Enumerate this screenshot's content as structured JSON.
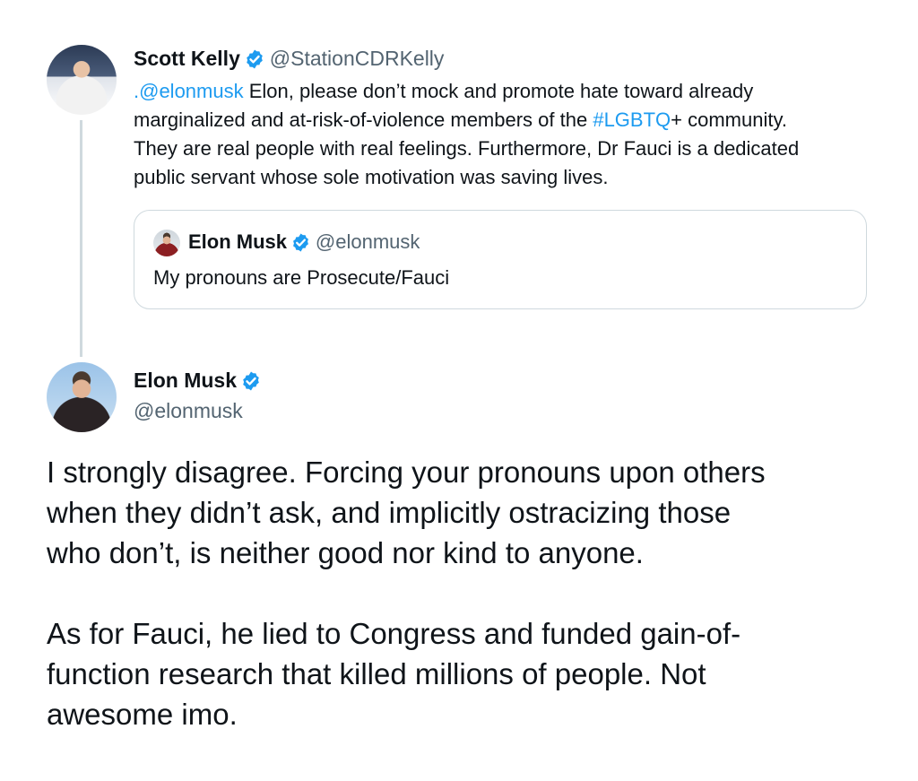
{
  "tweet1": {
    "name": "Scott Kelly",
    "handle": "@StationCDRKelly",
    "mention": ".@elonmusk",
    "text_part1": " Elon, please don’t mock and promote hate toward already",
    "text_line2_part1": "marginalized and at-risk-of-violence members of the ",
    "hashtag": "#LGBTQ",
    "text_line2_part2": "+ community.",
    "text_line3": "They are real people with real feelings. Furthermore, Dr Fauci is a dedicated",
    "text_line4": "public servant whose sole motivation was saving lives.",
    "avatar_icon": "astronaut-avatar",
    "verified_icon": "verified-badge-icon"
  },
  "quote": {
    "name": "Elon Musk",
    "handle": "@elonmusk",
    "text": "My pronouns are Prosecute/Fauci",
    "avatar_icon": "person-avatar"
  },
  "tweet2": {
    "name": "Elon Musk",
    "handle": "@elonmusk",
    "para1_line1": "I strongly disagree. Forcing your pronouns upon others",
    "para1_line2": "when they didn’t ask, and implicitly ostracizing those",
    "para1_line3": "who don’t, is neither good nor kind to anyone.",
    "para2_line1": "As for Fauci, he lied to Congress and funded gain-of-",
    "para2_line2": "function research that killed millions of people. Not",
    "para2_line3": "awesome imo.",
    "avatar_icon": "person-avatar"
  },
  "colors": {
    "link": "#1d9bf0",
    "verified": "#1d9bf0",
    "text": "#0f1419",
    "secondary": "#536471",
    "border": "#cfd9de"
  }
}
